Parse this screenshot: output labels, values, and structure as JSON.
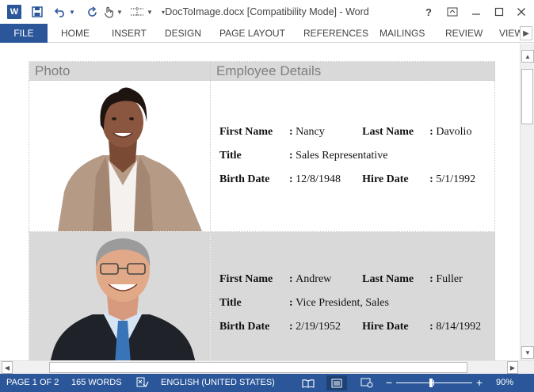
{
  "window": {
    "title": "DocToImage.docx [Compatibility Mode] - Word",
    "help_label": "?",
    "logo_letter": "W"
  },
  "ribbon": {
    "tabs": [
      "FILE",
      "HOME",
      "INSERT",
      "DESIGN",
      "PAGE LAYOUT",
      "REFERENCES",
      "MAILINGS",
      "REVIEW",
      "VIEW"
    ]
  },
  "table": {
    "headers": {
      "photo": "Photo",
      "details": "Employee Details"
    },
    "labels": {
      "first_name": "First Name",
      "last_name": "Last Name",
      "title": "Title",
      "birth_date": "Birth Date",
      "hire_date": "Hire Date",
      "separator": ":"
    },
    "employees": [
      {
        "first_name": "Nancy",
        "last_name": "Davolio",
        "title": "Sales Representative",
        "birth_date": "12/8/1948",
        "hire_date": "5/1/1992"
      },
      {
        "first_name": "Andrew",
        "last_name": "Fuller",
        "title": "Vice President, Sales",
        "birth_date": "2/19/1952",
        "hire_date": "8/14/1992"
      }
    ]
  },
  "status": {
    "page": "PAGE 1 OF 2",
    "words": "165 WORDS",
    "language": "ENGLISH (UNITED STATES)",
    "zoom_minus": "−",
    "zoom_plus": "+",
    "zoom": "90%"
  },
  "colors": {
    "accent": "#2b579a",
    "header_fill": "#d9d9d9"
  }
}
